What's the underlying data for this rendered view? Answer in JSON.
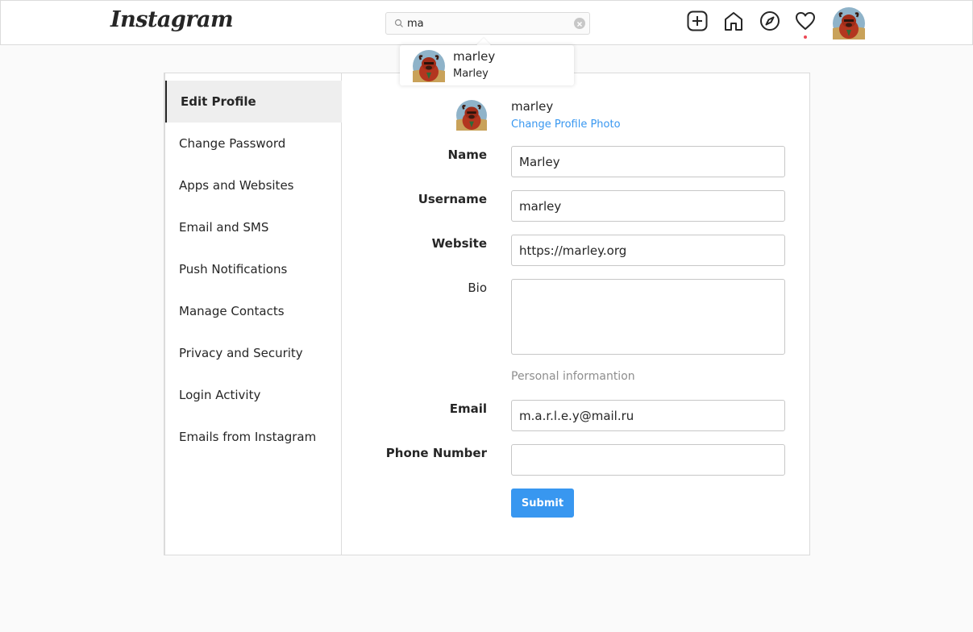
{
  "header": {
    "logo": "Instagram",
    "search": {
      "value": "ma",
      "icon": "search-icon"
    },
    "nav_icons": [
      "new-post-icon",
      "home-icon",
      "explore-icon",
      "activity-heart-icon",
      "profile-avatar"
    ],
    "notification_dot_color": "#ed4956"
  },
  "search_results": [
    {
      "username": "marley",
      "full_name": "Marley"
    }
  ],
  "sidebar": {
    "items": [
      {
        "label": "Edit Profile",
        "active": true
      },
      {
        "label": "Change Password"
      },
      {
        "label": "Apps and Websites"
      },
      {
        "label": "Email and SMS"
      },
      {
        "label": "Push Notifications"
      },
      {
        "label": "Manage Contacts"
      },
      {
        "label": "Privacy and Security"
      },
      {
        "label": "Login Activity"
      },
      {
        "label": "Emails from Instagram"
      }
    ]
  },
  "profile": {
    "username": "marley",
    "change_photo_label": "Change Profile Photo"
  },
  "form": {
    "name_label": "Name",
    "name_value": "Marley",
    "username_label": "Username",
    "username_value": "marley",
    "website_label": "Website",
    "website_value": "https://marley.org",
    "bio_label": "Bio",
    "bio_value": "",
    "section_title": "Personal informantion",
    "email_label": "Email",
    "email_value": "m.a.r.l.e.y@mail.ru",
    "phone_label": "Phone Number",
    "phone_value": "",
    "submit_label": "Submit"
  },
  "colors": {
    "accent": "#3897f0",
    "border": "#dbdbdb",
    "background": "#fafafa"
  }
}
